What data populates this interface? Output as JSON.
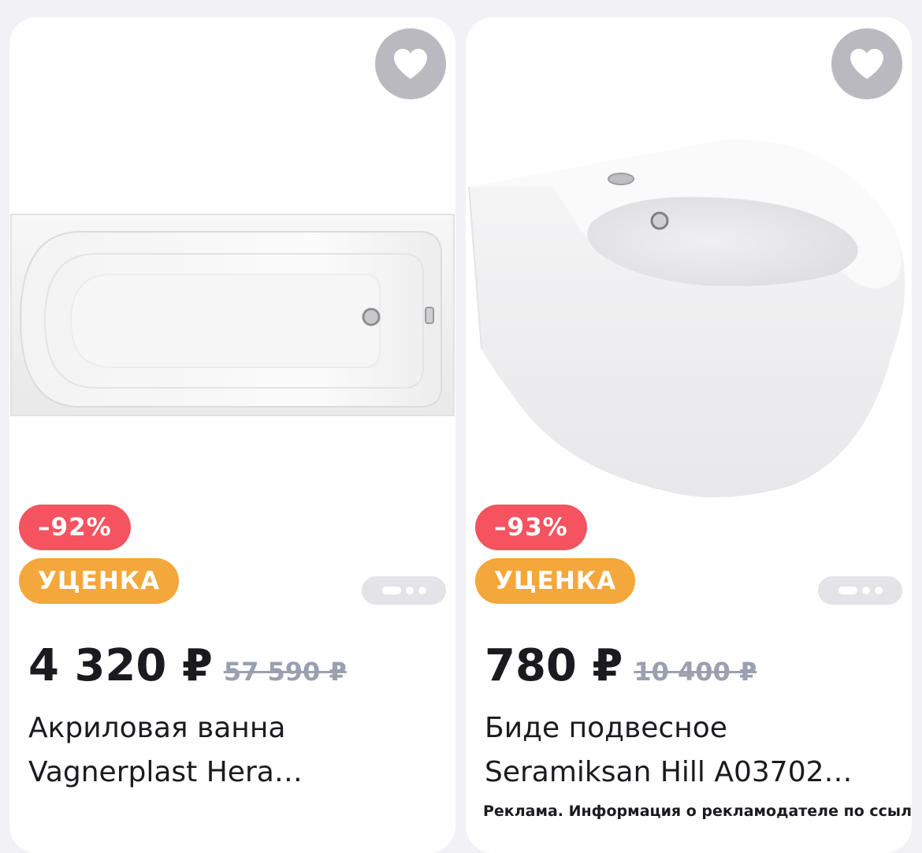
{
  "colors": {
    "discount_badge": "#f4535f",
    "markdown_badge": "#f4a73a",
    "favorite_button": "#b9b9bf",
    "old_price": "#9aa0b0"
  },
  "products": [
    {
      "image": "acrylic-bathtub",
      "favorite_icon": "heart-icon",
      "discount": "–92%",
      "markdown_label": "УЦЕНКА",
      "price": "4 320 ₽",
      "old_price": "57 590 ₽",
      "title": "Акриловая ванна\nVagnerplast Hera…",
      "carousel_pages": 3
    },
    {
      "image": "wall-hung-bidet",
      "favorite_icon": "heart-icon",
      "discount": "–93%",
      "markdown_label": "УЦЕНКА",
      "price": "780 ₽",
      "old_price": "10 400 ₽",
      "title": "Биде подвесное\nSeramiksan Hill A03702…",
      "carousel_pages": 3,
      "ad_note": "Реклама. Информация о рекламодателе по ссылке"
    }
  ]
}
